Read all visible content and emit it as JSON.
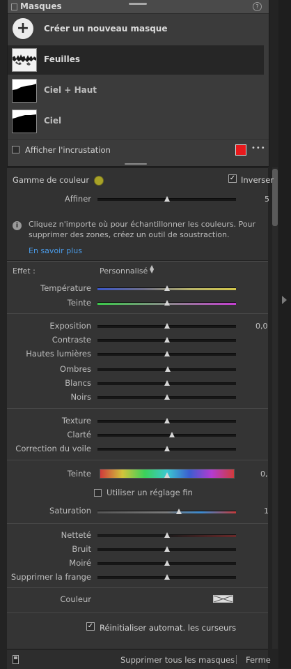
{
  "masks": {
    "title": "Masques",
    "create_label": "Créer un nouveau masque",
    "items": [
      {
        "label": "Feuilles"
      },
      {
        "label": "Ciel + Haut"
      },
      {
        "label": "Ciel"
      }
    ],
    "overlay_label": "Afficher l'incrustation",
    "overlay_color": "#e8191c",
    "more_label": "•••"
  },
  "color_range": {
    "label": "Gamme de couleur",
    "invert_label": "Inverser",
    "swatch_color": "#a8a227",
    "refine_label": "Affiner",
    "refine_value": "5",
    "refine_fraction": 0.5,
    "info_text": "Cliquez n'importe où pour échantillonner les couleurs. Pour supprimer des zones, créez un outil de soustraction.",
    "learn_more": "En savoir plus"
  },
  "effect": {
    "label": "Effet :",
    "preset": "Personnalisé",
    "groups": [
      [
        {
          "name": "temperature",
          "label": "Température",
          "value": "",
          "fraction": 0.5,
          "track": "linear-gradient(to right,#3b57c9,#6e6e8a,#b7b36a,#d2c64a)"
        },
        {
          "name": "tint",
          "label": "Teinte",
          "value": "",
          "fraction": 0.5,
          "track": "linear-gradient(to right,#3bc94a,#8a8a8a,#c43fd1)"
        }
      ],
      [
        {
          "name": "exposure",
          "label": "Exposition",
          "value": "0,0",
          "fraction": 0.5,
          "track": ""
        },
        {
          "name": "contrast",
          "label": "Contraste",
          "value": "",
          "fraction": 0.5,
          "track": ""
        },
        {
          "name": "highlights",
          "label": "Hautes lumières",
          "value": "",
          "fraction": 0.5,
          "track": ""
        },
        {
          "name": "shadows",
          "label": "Ombres",
          "value": "",
          "fraction": 0.51,
          "track": ""
        },
        {
          "name": "whites",
          "label": "Blancs",
          "value": "",
          "fraction": 0.5,
          "track": ""
        },
        {
          "name": "blacks",
          "label": "Noirs",
          "value": "",
          "fraction": 0.5,
          "track": ""
        }
      ],
      [
        {
          "name": "texture",
          "label": "Texture",
          "value": "",
          "fraction": 0.5,
          "track": ""
        },
        {
          "name": "clarity",
          "label": "Clarté",
          "value": "",
          "fraction": 0.54,
          "track": ""
        },
        {
          "name": "dehaze",
          "label": "Correction du voile",
          "value": "",
          "fraction": 0.5,
          "track": ""
        }
      ]
    ],
    "hue": {
      "label": "Teinte",
      "value": "0,",
      "fraction": 0.5
    },
    "fine_adjust_label": "Utiliser un réglage fin",
    "saturation": {
      "label": "Saturation",
      "value": "1",
      "fraction": 0.59
    },
    "detail_group": [
      {
        "name": "sharpness",
        "label": "Netteté",
        "value": "",
        "fraction": 0.5,
        "track": "linear-gradient(to right,#1a1a1a,#1a1a1a 50%,#6b2a2a)"
      },
      {
        "name": "noise",
        "label": "Bruit",
        "value": "",
        "fraction": 0.5,
        "track": ""
      },
      {
        "name": "moire",
        "label": "Moiré",
        "value": "",
        "fraction": 0.5,
        "track": ""
      },
      {
        "name": "defringe",
        "label": "Supprimer la frange",
        "value": "",
        "fraction": 0.5,
        "track": ""
      }
    ],
    "color_label": "Couleur",
    "auto_reset_label": "Réinitialiser automat. les curseurs"
  },
  "footer": {
    "delete_all": "Supprimer tous les masques",
    "close": "Ferme"
  }
}
